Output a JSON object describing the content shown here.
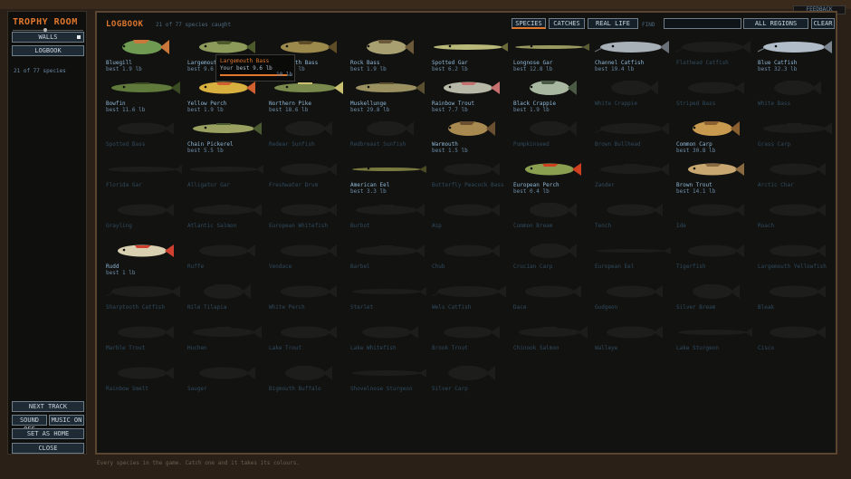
{
  "feedback_label": "FEEDBACK",
  "sidebar": {
    "title": "TROPHY ROOM",
    "walls_label": "WALLS",
    "logbook_label": "LOGBOOK",
    "count_text": "21 of 77 species",
    "next_track": "NEXT TRACK",
    "sound_off": "SOUND OFF",
    "music_on": "MUSIC ON",
    "set_home": "SET AS HOME",
    "close": "CLOSE"
  },
  "logbook": {
    "title": "LOGBOOK",
    "caught_text": "21 of 77 species caught",
    "tabs": [
      "SPECIES",
      "CATCHES",
      "REAL LIFE"
    ],
    "find_label": "FIND",
    "find_value": "",
    "region_label": "ALL REGIONS",
    "clear_label": "CLEAR"
  },
  "tooltip": {
    "title": "Largemouth Bass",
    "best": "Your best 9.6 lb",
    "progress_fraction": 0.92,
    "weight_label": "10 lb"
  },
  "footer_text": "Every species in the game. Catch one and it takes its colours.",
  "species": [
    {
      "name": "Bluegill",
      "best": "best 1.9 lb",
      "caught": true,
      "color": "#6f9a52",
      "accent": "#c9773a",
      "shape": "deep"
    },
    {
      "name": "Largemouth Bass",
      "best": "best 9.6 lb",
      "caught": true,
      "color": "#8c9a5a",
      "accent": "#4d5a2c",
      "shape": "normal"
    },
    {
      "name": "Smallmouth Bass",
      "best": "best 4.1 lb",
      "caught": true,
      "color": "#9c8a4c",
      "accent": "#5e4c26",
      "shape": "normal"
    },
    {
      "name": "Rock Bass",
      "best": "best 1.9 lb",
      "caught": true,
      "color": "#a8a070",
      "accent": "#6b5a3a",
      "shape": "deep"
    },
    {
      "name": "Spotted Gar",
      "best": "best 6.2 lb",
      "caught": true,
      "color": "#b8b878",
      "accent": "#6a6a3a",
      "shape": "gar"
    },
    {
      "name": "Longnose Gar",
      "best": "best 12.8 lb",
      "caught": true,
      "color": "#9a9a60",
      "accent": "#5a5a34",
      "shape": "eel"
    },
    {
      "name": "Channel Catfish",
      "best": "best 19.4 lb",
      "caught": true,
      "color": "#a8b0b8",
      "accent": "#6a7078",
      "shape": "cat"
    },
    {
      "name": "Flathead Catfish",
      "best": "",
      "caught": false,
      "color": "",
      "accent": "",
      "shape": "cat"
    },
    {
      "name": "Blue Catfish",
      "best": "best 32.3 lb",
      "caught": true,
      "color": "#b0bcc8",
      "accent": "#7a8590",
      "shape": "cat"
    },
    {
      "name": "Bowfin",
      "best": "best 11.6 lb",
      "caught": true,
      "color": "#5f7a3a",
      "accent": "#3a4a22",
      "shape": "long"
    },
    {
      "name": "Yellow Perch",
      "best": "best 1.9 lb",
      "caught": true,
      "color": "#d8b040",
      "accent": "#d06030",
      "shape": "normal"
    },
    {
      "name": "Northern Pike",
      "best": "best 18.6 lb",
      "caught": true,
      "color": "#7a8a4c",
      "accent": "#c8c070",
      "shape": "long"
    },
    {
      "name": "Muskellunge",
      "best": "best 29.8 lb",
      "caught": true,
      "color": "#9a9060",
      "accent": "#5a5030",
      "shape": "long"
    },
    {
      "name": "Rainbow Trout",
      "best": "best 7.7 lb",
      "caught": true,
      "color": "#b8b8a8",
      "accent": "#c87070",
      "shape": "normal"
    },
    {
      "name": "Black Crappie",
      "best": "best 1.9 lb",
      "caught": true,
      "color": "#a8b8a0",
      "accent": "#4a5a44",
      "shape": "deep"
    },
    {
      "name": "White Crappie",
      "best": "",
      "caught": false,
      "color": "",
      "accent": "",
      "shape": "deep"
    },
    {
      "name": "Striped Bass",
      "best": "",
      "caught": false,
      "color": "",
      "accent": "",
      "shape": "normal"
    },
    {
      "name": "White Bass",
      "best": "",
      "caught": false,
      "color": "",
      "accent": "",
      "shape": "deep"
    },
    {
      "name": "Spotted Bass",
      "best": "",
      "caught": false,
      "color": "",
      "accent": "",
      "shape": "normal"
    },
    {
      "name": "Chain Pickerel",
      "best": "best 5.5 lb",
      "caught": true,
      "color": "#9aa060",
      "accent": "#4a5a30",
      "shape": "long"
    },
    {
      "name": "Redear Sunfish",
      "best": "",
      "caught": false,
      "color": "",
      "accent": "",
      "shape": "deep"
    },
    {
      "name": "Redbreast Sunfish",
      "best": "",
      "caught": false,
      "color": "",
      "accent": "",
      "shape": "deep"
    },
    {
      "name": "Warmouth",
      "best": "best 1.5 lb",
      "caught": true,
      "color": "#a88a50",
      "accent": "#6a5030",
      "shape": "deep"
    },
    {
      "name": "Pumpkinseed",
      "best": "",
      "caught": false,
      "color": "",
      "accent": "",
      "shape": "deep"
    },
    {
      "name": "Brown Bullhead",
      "best": "",
      "caught": false,
      "color": "",
      "accent": "",
      "shape": "cat"
    },
    {
      "name": "Common Carp",
      "best": "best 30.8 lb",
      "caught": true,
      "color": "#c89a50",
      "accent": "#8a6030",
      "shape": "deep"
    },
    {
      "name": "Grass Carp",
      "best": "",
      "caught": false,
      "color": "",
      "accent": "",
      "shape": "long"
    },
    {
      "name": "Florida Gar",
      "best": "",
      "caught": false,
      "color": "",
      "accent": "",
      "shape": "gar"
    },
    {
      "name": "Alligator Gar",
      "best": "",
      "caught": false,
      "color": "",
      "accent": "",
      "shape": "gar"
    },
    {
      "name": "Freshwater Drum",
      "best": "",
      "caught": false,
      "color": "",
      "accent": "",
      "shape": "normal"
    },
    {
      "name": "American Eel",
      "best": "best 3.3 lb",
      "caught": true,
      "color": "#7a7a40",
      "accent": "#4a4a24",
      "shape": "eel"
    },
    {
      "name": "Butterfly Peacock Bass",
      "best": "",
      "caught": false,
      "color": "",
      "accent": "",
      "shape": "normal"
    },
    {
      "name": "European Perch",
      "best": "best 0.4 lb",
      "caught": true,
      "color": "#8aa050",
      "accent": "#d04020",
      "shape": "normal"
    },
    {
      "name": "Zander",
      "best": "",
      "caught": false,
      "color": "",
      "accent": "",
      "shape": "long"
    },
    {
      "name": "Brown Trout",
      "best": "best 14.1 lb",
      "caught": true,
      "color": "#c8a870",
      "accent": "#8a6a40",
      "shape": "normal"
    },
    {
      "name": "Arctic Char",
      "best": "",
      "caught": false,
      "color": "",
      "accent": "",
      "shape": "normal"
    },
    {
      "name": "Grayling",
      "best": "",
      "caught": false,
      "color": "",
      "accent": "",
      "shape": "normal"
    },
    {
      "name": "Atlantic Salmon",
      "best": "",
      "caught": false,
      "color": "",
      "accent": "",
      "shape": "long"
    },
    {
      "name": "European Whitefish",
      "best": "",
      "caught": false,
      "color": "",
      "accent": "",
      "shape": "normal"
    },
    {
      "name": "Burbot",
      "best": "",
      "caught": false,
      "color": "",
      "accent": "",
      "shape": "long"
    },
    {
      "name": "Asp",
      "best": "",
      "caught": false,
      "color": "",
      "accent": "",
      "shape": "normal"
    },
    {
      "name": "Common Bream",
      "best": "",
      "caught": false,
      "color": "",
      "accent": "",
      "shape": "deep"
    },
    {
      "name": "Tench",
      "best": "",
      "caught": false,
      "color": "",
      "accent": "",
      "shape": "normal"
    },
    {
      "name": "Ide",
      "best": "",
      "caught": false,
      "color": "",
      "accent": "",
      "shape": "normal"
    },
    {
      "name": "Roach",
      "best": "",
      "caught": false,
      "color": "",
      "accent": "",
      "shape": "normal"
    },
    {
      "name": "Rudd",
      "best": "best 1 lb",
      "caught": true,
      "color": "#d8d0b0",
      "accent": "#d04030",
      "shape": "normal"
    },
    {
      "name": "Ruffe",
      "best": "",
      "caught": false,
      "color": "",
      "accent": "",
      "shape": "normal"
    },
    {
      "name": "Vendace",
      "best": "",
      "caught": false,
      "color": "",
      "accent": "",
      "shape": "normal"
    },
    {
      "name": "Barbel",
      "best": "",
      "caught": false,
      "color": "",
      "accent": "",
      "shape": "long"
    },
    {
      "name": "Chub",
      "best": "",
      "caught": false,
      "color": "",
      "accent": "",
      "shape": "normal"
    },
    {
      "name": "Crucian Carp",
      "best": "",
      "caught": false,
      "color": "",
      "accent": "",
      "shape": "deep"
    },
    {
      "name": "European Eel",
      "best": "",
      "caught": false,
      "color": "",
      "accent": "",
      "shape": "eel"
    },
    {
      "name": "Tigerfish",
      "best": "",
      "caught": false,
      "color": "",
      "accent": "",
      "shape": "normal"
    },
    {
      "name": "Largemouth Yellowfish",
      "best": "",
      "caught": false,
      "color": "",
      "accent": "",
      "shape": "normal"
    },
    {
      "name": "Sharptooth Catfish",
      "best": "",
      "caught": false,
      "color": "",
      "accent": "",
      "shape": "cat"
    },
    {
      "name": "Nile Tilapia",
      "best": "",
      "caught": false,
      "color": "",
      "accent": "",
      "shape": "deep"
    },
    {
      "name": "White Perch",
      "best": "",
      "caught": false,
      "color": "",
      "accent": "",
      "shape": "normal"
    },
    {
      "name": "Sterlet",
      "best": "",
      "caught": false,
      "color": "",
      "accent": "",
      "shape": "gar"
    },
    {
      "name": "Wels Catfish",
      "best": "",
      "caught": false,
      "color": "",
      "accent": "",
      "shape": "cat"
    },
    {
      "name": "Dace",
      "best": "",
      "caught": false,
      "color": "",
      "accent": "",
      "shape": "normal"
    },
    {
      "name": "Gudgeon",
      "best": "",
      "caught": false,
      "color": "",
      "accent": "",
      "shape": "normal"
    },
    {
      "name": "Silver Bream",
      "best": "",
      "caught": false,
      "color": "",
      "accent": "",
      "shape": "deep"
    },
    {
      "name": "Bleak",
      "best": "",
      "caught": false,
      "color": "",
      "accent": "",
      "shape": "normal"
    },
    {
      "name": "Marble Trout",
      "best": "",
      "caught": false,
      "color": "",
      "accent": "",
      "shape": "normal"
    },
    {
      "name": "Huchen",
      "best": "",
      "caught": false,
      "color": "",
      "accent": "",
      "shape": "long"
    },
    {
      "name": "Lake Trout",
      "best": "",
      "caught": false,
      "color": "",
      "accent": "",
      "shape": "normal"
    },
    {
      "name": "Lake Whitefish",
      "best": "",
      "caught": false,
      "color": "",
      "accent": "",
      "shape": "normal"
    },
    {
      "name": "Brook Trout",
      "best": "",
      "caught": false,
      "color": "",
      "accent": "",
      "shape": "normal"
    },
    {
      "name": "Chinook Salmon",
      "best": "",
      "caught": false,
      "color": "",
      "accent": "",
      "shape": "long"
    },
    {
      "name": "Walleye",
      "best": "",
      "caught": false,
      "color": "",
      "accent": "",
      "shape": "normal"
    },
    {
      "name": "Lake Sturgeon",
      "best": "",
      "caught": false,
      "color": "",
      "accent": "",
      "shape": "gar"
    },
    {
      "name": "Cisco",
      "best": "",
      "caught": false,
      "color": "",
      "accent": "",
      "shape": "normal"
    },
    {
      "name": "Rainbow Smelt",
      "best": "",
      "caught": false,
      "color": "",
      "accent": "",
      "shape": "normal"
    },
    {
      "name": "Sauger",
      "best": "",
      "caught": false,
      "color": "",
      "accent": "",
      "shape": "normal"
    },
    {
      "name": "Bigmouth Buffalo",
      "best": "",
      "caught": false,
      "color": "",
      "accent": "",
      "shape": "deep"
    },
    {
      "name": "Shovelnose Sturgeon",
      "best": "",
      "caught": false,
      "color": "",
      "accent": "",
      "shape": "gar"
    },
    {
      "name": "Silver Carp",
      "best": "",
      "caught": false,
      "color": "",
      "accent": "",
      "shape": "deep"
    }
  ]
}
